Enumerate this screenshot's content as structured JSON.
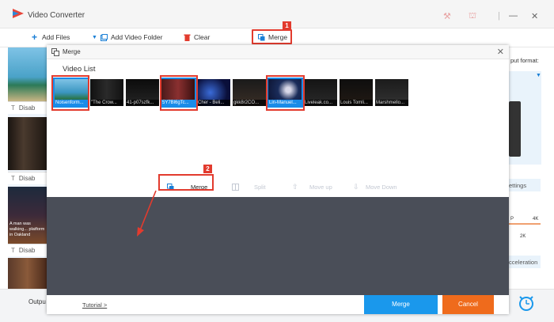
{
  "window": {
    "title": "Video Converter",
    "icons": [
      "key-icon",
      "cart-icon"
    ]
  },
  "toolbar": {
    "add_files": "Add Files",
    "add_video_folder": "Add Video Folder",
    "clear": "Clear",
    "merge": "Merge"
  },
  "callouts": {
    "step1": "1",
    "step2": "2"
  },
  "left_panel": {
    "items": [
      {
        "disable_label": "Disab"
      },
      {
        "disable_label": "Disab"
      },
      {
        "disable_label": "Disab"
      }
    ],
    "thumb_caption": "A man was walking... platform in Oakland"
  },
  "right_panel": {
    "output_format_label": "put format:",
    "settings_label": "ettings",
    "acceleration_label": "cceleration",
    "res_a": "P",
    "res_b": "4K",
    "res_c": "2K"
  },
  "bottom": {
    "output_label": "Outpu"
  },
  "dialog": {
    "title": "Merge",
    "video_list_label": "Video List",
    "videos": [
      {
        "caption": "Noisenform...",
        "selected": true
      },
      {
        "caption": "\"The Crow...",
        "selected": false
      },
      {
        "caption": "41-p07szfk...",
        "selected": false
      },
      {
        "caption": "5Y7Bl6gTc...",
        "selected": true
      },
      {
        "caption": "Cher - Beli...",
        "selected": false
      },
      {
        "caption": "gkk8r2CO...",
        "selected": false
      },
      {
        "caption": "Lin-Manuel...",
        "selected": true
      },
      {
        "caption": "Liveleak.co...",
        "selected": false
      },
      {
        "caption": "Louis Tomli...",
        "selected": false
      },
      {
        "caption": "Marshmello...",
        "selected": false
      }
    ],
    "actions": {
      "merge": "Merge",
      "split": "Split",
      "move_up": "Move up",
      "move_down": "Move Down"
    },
    "tutorial": "Tutorial >",
    "merge_button": "Merge",
    "cancel_button": "Cancel"
  },
  "colors": {
    "accent_blue": "#1a98ec",
    "cancel_orange": "#ef6b1c",
    "callout_red": "#e23b2e",
    "preview_bg": "#4a4e58"
  }
}
